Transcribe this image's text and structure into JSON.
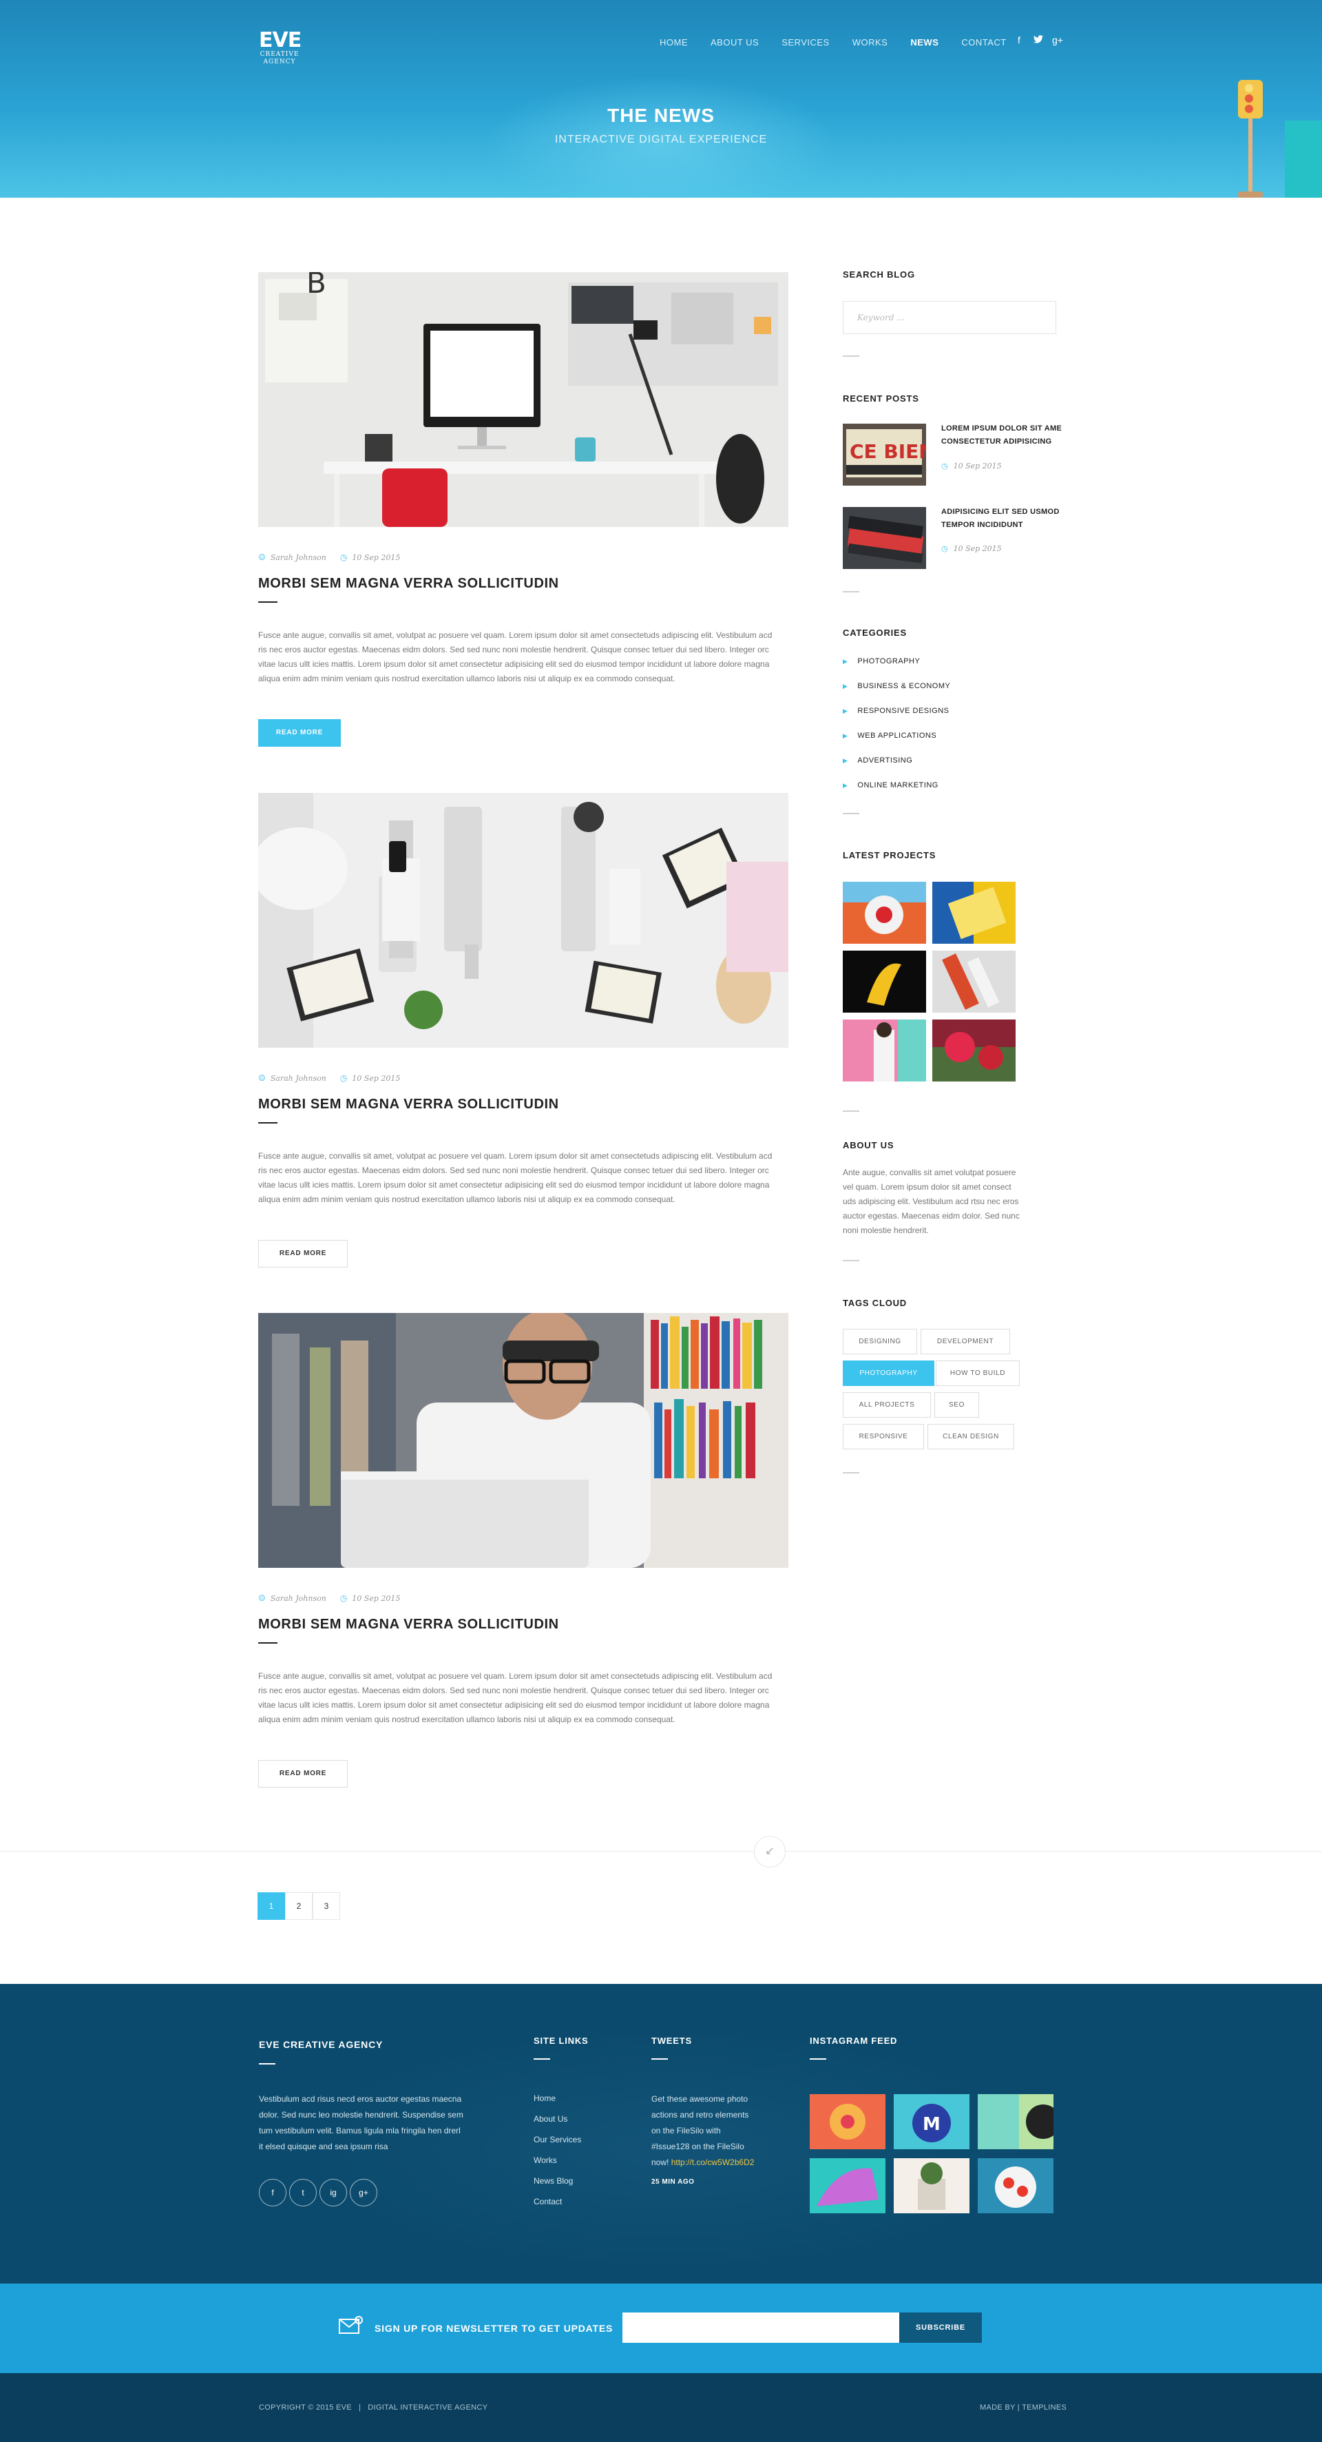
{
  "brand": {
    "mark": "EVE",
    "line1": "CREATIVE",
    "line2": "AGENCY"
  },
  "nav": [
    {
      "label": "HOME"
    },
    {
      "label": "ABOUT US"
    },
    {
      "label": "SERVICES"
    },
    {
      "label": "WORKS"
    },
    {
      "label": "NEWS",
      "active": true
    },
    {
      "label": "CONTACT"
    }
  ],
  "social_top": {
    "facebook": "f",
    "twitter": "t",
    "google": "g+"
  },
  "hero": {
    "title": "THE NEWS",
    "subtitle": "INTERACTIVE DIGITAL EXPERIENCE"
  },
  "posts": [
    {
      "author": "Sarah Johnson",
      "date": "10 Sep 2015",
      "title": "MORBI SEM MAGNA VERRA SOLLICITUDIN",
      "lines": [
        "Fusce ante augue, convallis sit amet, volutpat ac posuere vel quam. Lorem ipsum dolor sit amet consectetuds adipiscing elit. Vestibulum acd",
        "ris nec eros auctor egestas. Maecenas eidm dolors. Sed sed nunc noni molestie hendrerit. Quisque consec tetuer dui sed libero. Integer orc",
        "vitae lacus ullt icies mattis. Lorem ipsum dolor sit amet consectetur adipisicing elit sed do eiusmod tempor incididunt ut labore dolore magna",
        "aliqua enim adm minim veniam quis nostrud exercitation ullamco laboris nisi ut aliquip ex ea commodo consequat."
      ],
      "button": "READ MORE"
    },
    {
      "author": "Sarah Johnson",
      "date": "10 Sep 2015",
      "title": "MORBI SEM MAGNA VERRA SOLLICITUDIN",
      "lines": [
        "Fusce ante augue, convallis sit amet, volutpat ac posuere vel quam. Lorem ipsum dolor sit amet consectetuds adipiscing elit. Vestibulum acd",
        "ris nec eros auctor egestas. Maecenas eidm dolors. Sed sed nunc noni molestie hendrerit. Quisque consec tetuer dui sed libero. Integer orc",
        "vitae lacus ullt icies mattis. Lorem ipsum dolor sit amet consectetur adipisicing elit sed do eiusmod tempor incididunt ut labore dolore magna",
        "aliqua enim adm minim veniam quis nostrud exercitation ullamco laboris nisi ut aliquip ex ea commodo consequat."
      ],
      "button": "READ MORE"
    },
    {
      "author": "Sarah Johnson",
      "date": "10 Sep 2015",
      "title": "MORBI SEM MAGNA VERRA SOLLICITUDIN",
      "lines": [
        "Fusce ante augue, convallis sit amet, volutpat ac posuere vel quam. Lorem ipsum dolor sit amet consectetuds adipiscing elit. Vestibulum acd",
        "ris nec eros auctor egestas. Maecenas eidm dolors. Sed sed nunc noni molestie hendrerit. Quisque consec tetuer dui sed libero. Integer orc",
        "vitae lacus ullt icies mattis. Lorem ipsum dolor sit amet consectetur adipisicing elit sed do eiusmod tempor incididunt ut labore dolore magna",
        "aliqua enim adm minim veniam quis nostrud exercitation ullamco laboris nisi ut aliquip ex ea commodo consequat."
      ],
      "button": "READ MORE"
    }
  ],
  "sidebar": {
    "search": {
      "title": "SEARCH BLOG",
      "placeholder": "Keyword ..."
    },
    "recent": {
      "title": "RECENT POSTS",
      "items": [
        {
          "line1": "LOREM IPSUM DOLOR SIT AME",
          "line2": "CONSECTETUR ADIPISICING",
          "date": "10 Sep 2015"
        },
        {
          "line1": "ADIPISICING ELIT SED USMOD",
          "line2": "TEMPOR INCIDIDUNT",
          "date": "10 Sep 2015"
        }
      ]
    },
    "categories": {
      "title": "CATEGORIES",
      "items": [
        "PHOTOGRAPHY",
        "BUSINESS & ECONOMY",
        "RESPONSIVE DESIGNS",
        "WEB APPLICATIONS",
        "ADVERTISING",
        "ONLINE MARKETING"
      ]
    },
    "projects": {
      "title": "LATEST PROJECTS"
    },
    "about": {
      "title": "ABOUT US",
      "lines": [
        "Ante augue, convallis sit amet volutpat posuere",
        "vel quam. Lorem ipsum dolor sit amet consect",
        "uds adipiscing elit. Vestibulum acd rtsu nec eros",
        "auctor egestas. Maecenas eidm dolor. Sed nunc",
        "noni molestie hendrerit."
      ]
    },
    "tags": {
      "title": "TAGS CLOUD",
      "items": [
        {
          "label": "DESIGNING"
        },
        {
          "label": "DEVELOPMENT"
        },
        {
          "label": "PHOTOGRAPHY",
          "active": true
        },
        {
          "label": "HOW TO BUILD"
        },
        {
          "label": "ALL PROJECTS"
        },
        {
          "label": "SEO"
        },
        {
          "label": "RESPONSIVE"
        },
        {
          "label": "CLEAN DESIGN"
        }
      ]
    }
  },
  "pagination": {
    "pages": [
      "1",
      "2",
      "3"
    ],
    "current": "1"
  },
  "footer": {
    "agency": {
      "title": "EVE CREATIVE AGENCY",
      "lines": [
        "Vestibulum acd risus necd eros auctor egestas maecna",
        "dolor. Sed nunc leo molestie hendrerit. Suspendise sem",
        "tum vestibulum velit. Bamus ligula mla fringila hen drerl",
        "it elsed quisque and sea ipsum risa"
      ],
      "social": [
        "f",
        "t",
        "ig",
        "g+"
      ]
    },
    "links": {
      "title": "SITE LINKS",
      "items": [
        "Home",
        "About Us",
        "Our Services",
        "Works",
        "News Blog",
        "Contact"
      ]
    },
    "tweets": {
      "title": "TWEETS",
      "lines": [
        "Get these awesome photo",
        "actions and retro elements",
        "on the FileSilo with",
        "#Issue128 on the FileSilo"
      ],
      "last_prefix": "now! ",
      "link": "http://t.co/cw5W2b6D2",
      "time": "25 MIN AGO"
    },
    "instagram": {
      "title": "INSTAGRAM FEED"
    }
  },
  "newsletter": {
    "text": "SIGN UP FOR NEWSLETTER TO GET UPDATES",
    "button": "SUBSCRIBE"
  },
  "copyright": {
    "left": "COPYRIGHT © 2015 EVE   |   DIGITAL INTERACTIVE AGENCY",
    "right": "MADE BY | TEMPLINES"
  },
  "colors": {
    "accent": "#3cc3ee",
    "footer": "#0b4a6c",
    "newsletter": "#1ea1d9"
  }
}
